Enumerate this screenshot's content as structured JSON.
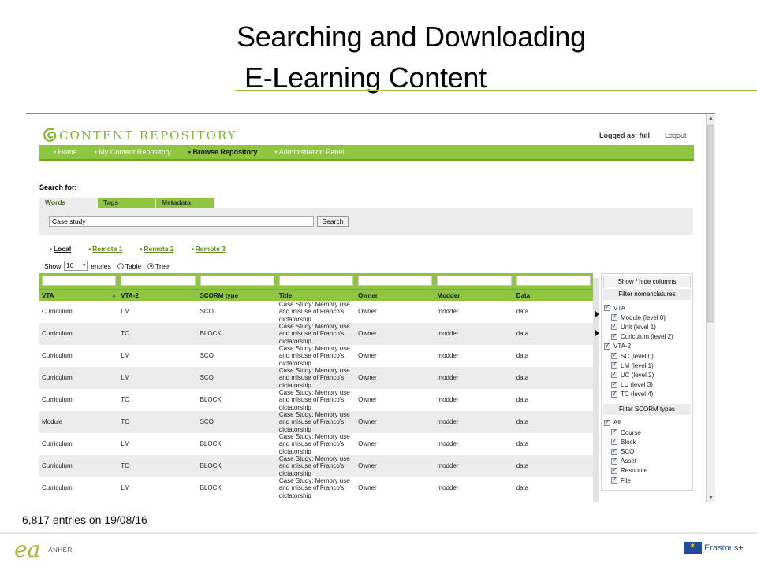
{
  "slide": {
    "title_line1": "Searching and Downloading",
    "title_line2": " E-Learning Content",
    "entries_note": "6,817 entries on 19/08/16",
    "footer_logo_left": "ANHER",
    "footer_logo_right": "Erasmus+"
  },
  "app": {
    "brand": "CONTENT REPOSITORY",
    "logged_as": "Logged as: full",
    "logout": "Logout",
    "menu": [
      {
        "label": "• Home",
        "active": false
      },
      {
        "label": "• My Content Repository",
        "active": false
      },
      {
        "label": "• Browse Repository",
        "active": true
      },
      {
        "label": "• Administration Panel",
        "active": false
      }
    ],
    "search_for_label": "Search for:",
    "tabs": [
      "Words",
      "Tags",
      "Metadata"
    ],
    "search_value": "Case study",
    "search_button": "Search",
    "repos": [
      "Local",
      "Remote 1",
      "Remote 2",
      "Remote 3"
    ],
    "show_label": "Show",
    "show_value": "10",
    "entries_label": "entries",
    "view_table": "Table",
    "view_tree": "Tree",
    "columns": [
      "VTA",
      "VTA-2",
      "SCORM type",
      "Title",
      "Owner",
      "Modder",
      "Data"
    ],
    "rows": [
      [
        "Curriculum",
        "LM",
        "SCO",
        "Case Study: Memory use and misuse of Franco's dictatorship",
        "Owner",
        "modder",
        "data"
      ],
      [
        "Curriculum",
        "TC",
        "BLOCK",
        "Case Study: Memory use and misuse of Franco's dictatorship",
        "Owner",
        "modder",
        "data"
      ],
      [
        "Curriculum",
        "LM",
        "SCO",
        "Case Study: Memory use and misuse of Franco's dictatorship",
        "Owner",
        "modder",
        "data"
      ],
      [
        "Curriculum",
        "LM",
        "SCO",
        "Case Study: Memory use and misuse of Franco's dictatorship",
        "Owner",
        "modder",
        "data"
      ],
      [
        "Curriculum",
        "TC",
        "BLOCK",
        "Case Study: Memory use and misuse of Franco's dictatorship",
        "Owner",
        "modder",
        "data"
      ],
      [
        "Module",
        "TC",
        "SCO",
        "Case Study: Memory use and misuse of Franco's dictatorship",
        "Owner",
        "modder",
        "data"
      ],
      [
        "Curriculum",
        "LM",
        "BLOCK",
        "Case Study: Memory use and misuse of Franco's dictatorship",
        "Owner",
        "modder",
        "data"
      ],
      [
        "Curriculum",
        "TC",
        "BLOCK",
        "Case Study: Memory use and misuse of Franco's dictatorship",
        "Owner",
        "modder",
        "data"
      ],
      [
        "Curriculum",
        "LM",
        "BLOCK",
        "Case Study: Memory use and misuse of Franco's dictatorship",
        "Owner",
        "modder",
        "data"
      ]
    ],
    "side": {
      "show_hide": "Show / hide columns",
      "filter_nom": "Filter nomenclatures",
      "nomenclatures": [
        {
          "label": "VTA",
          "level": 0
        },
        {
          "label": "Module (level 0)",
          "level": 1
        },
        {
          "label": "Unit (level 1)",
          "level": 1
        },
        {
          "label": "Curiculum (level 2)",
          "level": 1
        },
        {
          "label": "VTA-2",
          "level": 0
        },
        {
          "label": "SC (level 0)",
          "level": 1
        },
        {
          "label": "LM (level 1)",
          "level": 1
        },
        {
          "label": "UC (level 2)",
          "level": 1
        },
        {
          "label": "LU (level 3)",
          "level": 1
        },
        {
          "label": "TC (level 4)",
          "level": 1
        }
      ],
      "filter_scorm": "Filter SCORM types",
      "scorm": [
        {
          "label": "All",
          "level": 0
        },
        {
          "label": "Course",
          "level": 1
        },
        {
          "label": "Block",
          "level": 1
        },
        {
          "label": "SCO",
          "level": 1
        },
        {
          "label": "Asset",
          "level": 1
        },
        {
          "label": "Resource",
          "level": 1
        },
        {
          "label": "File",
          "level": 1
        }
      ]
    }
  }
}
